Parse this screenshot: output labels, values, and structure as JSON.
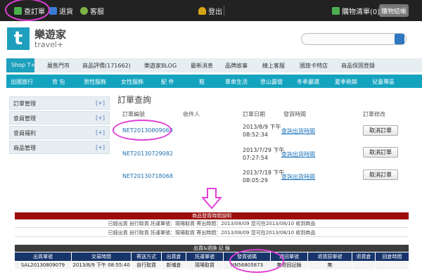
{
  "topbar": {
    "check_orders": "查訂單",
    "returns": "退貨",
    "support": "客服",
    "logout": "登出",
    "cart": "購物清單(0)",
    "checkout": "購物結帳"
  },
  "logo": {
    "name": "樂遊家",
    "sub": "travel+",
    "mark": "t"
  },
  "nav1": {
    "items": [
      "Shop T+",
      "展售門市",
      "商品評價(171662)",
      "樂遊家BLOG",
      "最新消息",
      "品牌故事",
      "線上客服",
      "國旅卡特店",
      "商品保固登錄"
    ]
  },
  "nav2": {
    "items": [
      "出國旅行",
      "背 包",
      "男性服飾",
      "女性服飾",
      "配 件",
      "鞋",
      "單車生活",
      "登山露營",
      "冬季嚴選",
      "夏季熱銷",
      "兒童專區"
    ]
  },
  "sidebar": {
    "items": [
      {
        "label": "訂單管理",
        "toggle": "[+]"
      },
      {
        "label": "會員管理",
        "toggle": "[+]"
      },
      {
        "label": "會員福利",
        "toggle": "[+]"
      },
      {
        "label": "商品管理",
        "toggle": "[+]"
      }
    ]
  },
  "orders": {
    "title": "訂單查詢",
    "headers": [
      "訂單編號",
      "收件人",
      "訂單日期",
      "發貨時間",
      "訂單修改"
    ],
    "rows": [
      {
        "id": "NET20130809068",
        "date1": "2013/8/9 下午",
        "date2": "08:52:34",
        "ship": "查詢出貨時間",
        "action": "取消訂單"
      },
      {
        "id": "NET20130729082",
        "date1": "2013/7/29 下午",
        "date2": "07:27:54",
        "ship": "查詢出貨時間",
        "action": "取消訂單"
      },
      {
        "id": "NET20130718068",
        "date1": "2013/7/18 下午",
        "date2": "08:05:29",
        "ship": "查詢出貨時間",
        "action": "取消訂單"
      }
    ]
  },
  "arrow": "⇩",
  "shipping": {
    "title": "商品發貨時間說明",
    "lines": [
      "已經出貨 自行取貨 託運單號：現場取貨 寄出時間：2013/08/09 您可在2013/08/10 收到商品",
      "已經出貨 自行取貨 託運單號：現場取貨 寄出時間：2013/08/09 您可在2013/08/10 收到商品"
    ]
  },
  "records": {
    "title": "出貨&退換 記 錄",
    "headers": [
      "出貨單號",
      "交易時間",
      "寄送方式",
      "出貨倉",
      "託運單號",
      "發貨號碼",
      "退回單號",
      "退貨原單號",
      "退貨倉",
      "回倉時間"
    ],
    "row": [
      "SAL20130809079",
      "2013/8/9 下午 08:55:40",
      "自行取貨",
      "新埔倉",
      "現場取貨",
      "NN56805873",
      "無退回記錄",
      "無",
      "",
      ""
    ]
  },
  "colors": {
    "accent": "#1d9fbd",
    "highlight": "#e040d8",
    "banner": "#9b0d0d",
    "header": "#17346b"
  }
}
